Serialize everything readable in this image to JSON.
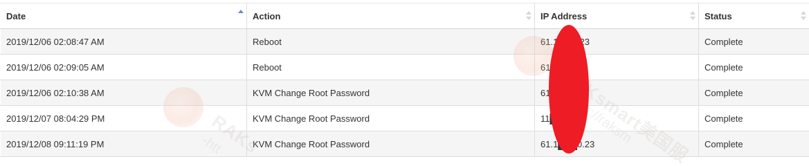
{
  "table": {
    "columns": [
      {
        "label": "Date",
        "sort": "asc"
      },
      {
        "label": "Action",
        "sort": "none"
      },
      {
        "label": "IP Address",
        "sort": "none"
      },
      {
        "label": "Status",
        "sort": "none"
      }
    ],
    "rows": [
      {
        "date": "2019/12/06 02:08:47 AM",
        "action": "Reboot",
        "ip": "61.1███.23",
        "status": "Complete"
      },
      {
        "date": "2019/12/06 02:09:05 AM",
        "action": "Reboot",
        "ip": "61███.23",
        "status": "Complete"
      },
      {
        "date": "2019/12/06 02:10:38 AM",
        "action": "KVM Change Root Password",
        "ip": "61███.23",
        "status": "Complete"
      },
      {
        "date": "2019/12/07 08:04:29 PM",
        "action": "KVM Change Root Password",
        "ip": "11███.143",
        "status": "Complete"
      },
      {
        "date": "2019/12/08 09:11:19 PM",
        "action": "KVM Change Root Password",
        "ip": "61.1███0.23",
        "status": "Complete"
      }
    ]
  },
  "watermark": {
    "brand": "RAKsmart美国服",
    "brand_left": "RAKs",
    "url": "-https://raksm",
    "url_left": "-htt"
  },
  "colors": {
    "sort_active": "#7185cc",
    "sort_inactive": "#d6d6d6",
    "row_striped": "#f5f5f5",
    "border": "#dddddd",
    "redaction": "#ee1c25"
  }
}
